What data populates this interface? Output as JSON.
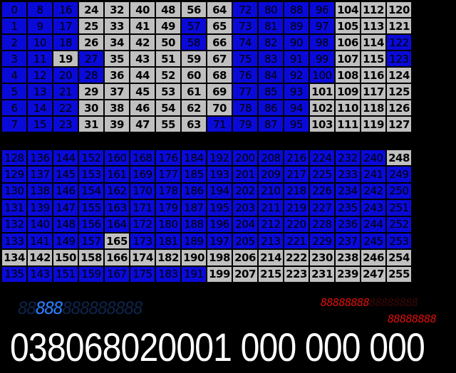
{
  "grid_top": {
    "cells": [
      {
        "v": "0",
        "on": true
      },
      {
        "v": "1",
        "on": true
      },
      {
        "v": "2",
        "on": true
      },
      {
        "v": "3",
        "on": true
      },
      {
        "v": "4",
        "on": true
      },
      {
        "v": "5",
        "on": true
      },
      {
        "v": "6",
        "on": true
      },
      {
        "v": "7",
        "on": true
      },
      {
        "v": "8",
        "on": true
      },
      {
        "v": "9",
        "on": true
      },
      {
        "v": "10",
        "on": true
      },
      {
        "v": "11",
        "on": true
      },
      {
        "v": "12",
        "on": true
      },
      {
        "v": "13",
        "on": true
      },
      {
        "v": "14",
        "on": true
      },
      {
        "v": "15",
        "on": true
      },
      {
        "v": "16",
        "on": true
      },
      {
        "v": "17",
        "on": true
      },
      {
        "v": "18",
        "on": true
      },
      {
        "v": "19",
        "on": false
      },
      {
        "v": "20",
        "on": true
      },
      {
        "v": "21",
        "on": true
      },
      {
        "v": "22",
        "on": true
      },
      {
        "v": "23",
        "on": true
      },
      {
        "v": "24",
        "on": false
      },
      {
        "v": "25",
        "on": false
      },
      {
        "v": "26",
        "on": false
      },
      {
        "v": "27",
        "on": true
      },
      {
        "v": "28",
        "on": true
      },
      {
        "v": "29",
        "on": false
      },
      {
        "v": "30",
        "on": false
      },
      {
        "v": "31",
        "on": false
      },
      {
        "v": "32",
        "on": false
      },
      {
        "v": "33",
        "on": false
      },
      {
        "v": "34",
        "on": false
      },
      {
        "v": "35",
        "on": false
      },
      {
        "v": "36",
        "on": false
      },
      {
        "v": "37",
        "on": false
      },
      {
        "v": "38",
        "on": false
      },
      {
        "v": "39",
        "on": false
      },
      {
        "v": "40",
        "on": false
      },
      {
        "v": "41",
        "on": false
      },
      {
        "v": "42",
        "on": false
      },
      {
        "v": "43",
        "on": false
      },
      {
        "v": "44",
        "on": false
      },
      {
        "v": "45",
        "on": false
      },
      {
        "v": "46",
        "on": false
      },
      {
        "v": "47",
        "on": false
      },
      {
        "v": "48",
        "on": false
      },
      {
        "v": "49",
        "on": false
      },
      {
        "v": "50",
        "on": false
      },
      {
        "v": "51",
        "on": false
      },
      {
        "v": "52",
        "on": false
      },
      {
        "v": "53",
        "on": false
      },
      {
        "v": "54",
        "on": false
      },
      {
        "v": "55",
        "on": false
      },
      {
        "v": "56",
        "on": false
      },
      {
        "v": "57",
        "on": true
      },
      {
        "v": "58",
        "on": true
      },
      {
        "v": "59",
        "on": false
      },
      {
        "v": "60",
        "on": false
      },
      {
        "v": "61",
        "on": false
      },
      {
        "v": "62",
        "on": false
      },
      {
        "v": "63",
        "on": false
      },
      {
        "v": "64",
        "on": false
      },
      {
        "v": "65",
        "on": false
      },
      {
        "v": "66",
        "on": false
      },
      {
        "v": "67",
        "on": false
      },
      {
        "v": "68",
        "on": false
      },
      {
        "v": "69",
        "on": false
      },
      {
        "v": "70",
        "on": false
      },
      {
        "v": "71",
        "on": true
      },
      {
        "v": "72",
        "on": true
      },
      {
        "v": "73",
        "on": true
      },
      {
        "v": "74",
        "on": true
      },
      {
        "v": "75",
        "on": true
      },
      {
        "v": "76",
        "on": true
      },
      {
        "v": "77",
        "on": true
      },
      {
        "v": "78",
        "on": true
      },
      {
        "v": "79",
        "on": true
      },
      {
        "v": "80",
        "on": true
      },
      {
        "v": "81",
        "on": true
      },
      {
        "v": "82",
        "on": true
      },
      {
        "v": "83",
        "on": true
      },
      {
        "v": "84",
        "on": true
      },
      {
        "v": "85",
        "on": true
      },
      {
        "v": "86",
        "on": true
      },
      {
        "v": "87",
        "on": true
      },
      {
        "v": "88",
        "on": true
      },
      {
        "v": "89",
        "on": true
      },
      {
        "v": "90",
        "on": true
      },
      {
        "v": "91",
        "on": true
      },
      {
        "v": "92",
        "on": true
      },
      {
        "v": "93",
        "on": true
      },
      {
        "v": "94",
        "on": true
      },
      {
        "v": "95",
        "on": true
      },
      {
        "v": "96",
        "on": true
      },
      {
        "v": "97",
        "on": true
      },
      {
        "v": "98",
        "on": true
      },
      {
        "v": "99",
        "on": true
      },
      {
        "v": "100",
        "on": true
      },
      {
        "v": "101",
        "on": false
      },
      {
        "v": "102",
        "on": false
      },
      {
        "v": "103",
        "on": false
      },
      {
        "v": "104",
        "on": false
      },
      {
        "v": "105",
        "on": false
      },
      {
        "v": "106",
        "on": false
      },
      {
        "v": "107",
        "on": false
      },
      {
        "v": "108",
        "on": false
      },
      {
        "v": "109",
        "on": false
      },
      {
        "v": "110",
        "on": false
      },
      {
        "v": "111",
        "on": false
      },
      {
        "v": "112",
        "on": false
      },
      {
        "v": "113",
        "on": false
      },
      {
        "v": "114",
        "on": false
      },
      {
        "v": "115",
        "on": false
      },
      {
        "v": "116",
        "on": false
      },
      {
        "v": "117",
        "on": false
      },
      {
        "v": "118",
        "on": false
      },
      {
        "v": "119",
        "on": false
      },
      {
        "v": "120",
        "on": false
      },
      {
        "v": "121",
        "on": false
      },
      {
        "v": "122",
        "on": true
      },
      {
        "v": "123",
        "on": true
      },
      {
        "v": "124",
        "on": false
      },
      {
        "v": "125",
        "on": false
      },
      {
        "v": "126",
        "on": false
      },
      {
        "v": "127",
        "on": false
      }
    ]
  },
  "grid_bottom": {
    "cells": [
      {
        "v": "128",
        "on": true
      },
      {
        "v": "129",
        "on": true
      },
      {
        "v": "130",
        "on": true
      },
      {
        "v": "131",
        "on": true
      },
      {
        "v": "132",
        "on": true
      },
      {
        "v": "133",
        "on": true
      },
      {
        "v": "134",
        "on": false
      },
      {
        "v": "135",
        "on": true
      },
      {
        "v": "136",
        "on": true
      },
      {
        "v": "137",
        "on": true
      },
      {
        "v": "138",
        "on": true
      },
      {
        "v": "139",
        "on": true
      },
      {
        "v": "140",
        "on": true
      },
      {
        "v": "141",
        "on": true
      },
      {
        "v": "142",
        "on": false
      },
      {
        "v": "143",
        "on": true
      },
      {
        "v": "144",
        "on": true
      },
      {
        "v": "145",
        "on": true
      },
      {
        "v": "146",
        "on": true
      },
      {
        "v": "147",
        "on": true
      },
      {
        "v": "148",
        "on": true
      },
      {
        "v": "149",
        "on": true
      },
      {
        "v": "150",
        "on": false
      },
      {
        "v": "151",
        "on": true
      },
      {
        "v": "152",
        "on": true
      },
      {
        "v": "153",
        "on": true
      },
      {
        "v": "154",
        "on": true
      },
      {
        "v": "155",
        "on": true
      },
      {
        "v": "156",
        "on": true
      },
      {
        "v": "157",
        "on": true
      },
      {
        "v": "158",
        "on": false
      },
      {
        "v": "159",
        "on": true
      },
      {
        "v": "160",
        "on": true
      },
      {
        "v": "161",
        "on": true
      },
      {
        "v": "162",
        "on": true
      },
      {
        "v": "163",
        "on": true
      },
      {
        "v": "164",
        "on": true
      },
      {
        "v": "165",
        "on": false
      },
      {
        "v": "166",
        "on": false
      },
      {
        "v": "167",
        "on": true
      },
      {
        "v": "168",
        "on": true
      },
      {
        "v": "169",
        "on": true
      },
      {
        "v": "170",
        "on": true
      },
      {
        "v": "171",
        "on": true
      },
      {
        "v": "172",
        "on": true
      },
      {
        "v": "173",
        "on": true
      },
      {
        "v": "174",
        "on": false
      },
      {
        "v": "175",
        "on": true
      },
      {
        "v": "176",
        "on": true
      },
      {
        "v": "177",
        "on": true
      },
      {
        "v": "178",
        "on": true
      },
      {
        "v": "179",
        "on": true
      },
      {
        "v": "180",
        "on": true
      },
      {
        "v": "181",
        "on": true
      },
      {
        "v": "182",
        "on": false
      },
      {
        "v": "183",
        "on": true
      },
      {
        "v": "184",
        "on": true
      },
      {
        "v": "185",
        "on": true
      },
      {
        "v": "186",
        "on": true
      },
      {
        "v": "187",
        "on": true
      },
      {
        "v": "188",
        "on": true
      },
      {
        "v": "189",
        "on": true
      },
      {
        "v": "190",
        "on": false
      },
      {
        "v": "191",
        "on": true
      },
      {
        "v": "192",
        "on": true
      },
      {
        "v": "193",
        "on": true
      },
      {
        "v": "194",
        "on": true
      },
      {
        "v": "195",
        "on": true
      },
      {
        "v": "196",
        "on": true
      },
      {
        "v": "197",
        "on": true
      },
      {
        "v": "198",
        "on": false
      },
      {
        "v": "199",
        "on": false
      },
      {
        "v": "200",
        "on": true
      },
      {
        "v": "201",
        "on": true
      },
      {
        "v": "202",
        "on": true
      },
      {
        "v": "203",
        "on": true
      },
      {
        "v": "204",
        "on": true
      },
      {
        "v": "205",
        "on": true
      },
      {
        "v": "206",
        "on": false
      },
      {
        "v": "207",
        "on": false
      },
      {
        "v": "208",
        "on": true
      },
      {
        "v": "209",
        "on": true
      },
      {
        "v": "210",
        "on": true
      },
      {
        "v": "211",
        "on": true
      },
      {
        "v": "212",
        "on": true
      },
      {
        "v": "213",
        "on": true
      },
      {
        "v": "214",
        "on": false
      },
      {
        "v": "215",
        "on": false
      },
      {
        "v": "216",
        "on": true
      },
      {
        "v": "217",
        "on": true
      },
      {
        "v": "218",
        "on": true
      },
      {
        "v": "219",
        "on": true
      },
      {
        "v": "220",
        "on": true
      },
      {
        "v": "221",
        "on": true
      },
      {
        "v": "222",
        "on": false
      },
      {
        "v": "223",
        "on": false
      },
      {
        "v": "224",
        "on": true
      },
      {
        "v": "225",
        "on": true
      },
      {
        "v": "226",
        "on": true
      },
      {
        "v": "227",
        "on": true
      },
      {
        "v": "228",
        "on": true
      },
      {
        "v": "229",
        "on": true
      },
      {
        "v": "230",
        "on": false
      },
      {
        "v": "231",
        "on": false
      },
      {
        "v": "232",
        "on": true
      },
      {
        "v": "233",
        "on": true
      },
      {
        "v": "234",
        "on": true
      },
      {
        "v": "235",
        "on": true
      },
      {
        "v": "236",
        "on": true
      },
      {
        "v": "237",
        "on": true
      },
      {
        "v": "238",
        "on": false
      },
      {
        "v": "239",
        "on": false
      },
      {
        "v": "240",
        "on": true
      },
      {
        "v": "241",
        "on": true
      },
      {
        "v": "242",
        "on": true
      },
      {
        "v": "243",
        "on": true
      },
      {
        "v": "244",
        "on": true
      },
      {
        "v": "245",
        "on": true
      },
      {
        "v": "246",
        "on": false
      },
      {
        "v": "247",
        "on": false
      },
      {
        "v": "248",
        "on": false
      },
      {
        "v": "249",
        "on": true
      },
      {
        "v": "250",
        "on": true
      },
      {
        "v": "251",
        "on": true
      },
      {
        "v": "252",
        "on": true
      },
      {
        "v": "253",
        "on": true
      },
      {
        "v": "254",
        "on": false
      },
      {
        "v": "255",
        "on": false
      }
    ]
  },
  "lcd_left": {
    "dim_prefix": "88",
    "bright": "888",
    "dim_suffix": "888888888"
  },
  "lcd_right_top": {
    "bright": "88888888",
    "dim": "88888888"
  },
  "lcd_right_bottom": {
    "bright": "88888888"
  },
  "readout": "03806802000​1 000 000 000",
  "colors": {
    "on": "#0a0ad8",
    "off": "#c0c0c0",
    "lcd_blue": "#2a7cff",
    "lcd_red": "#e01010"
  }
}
